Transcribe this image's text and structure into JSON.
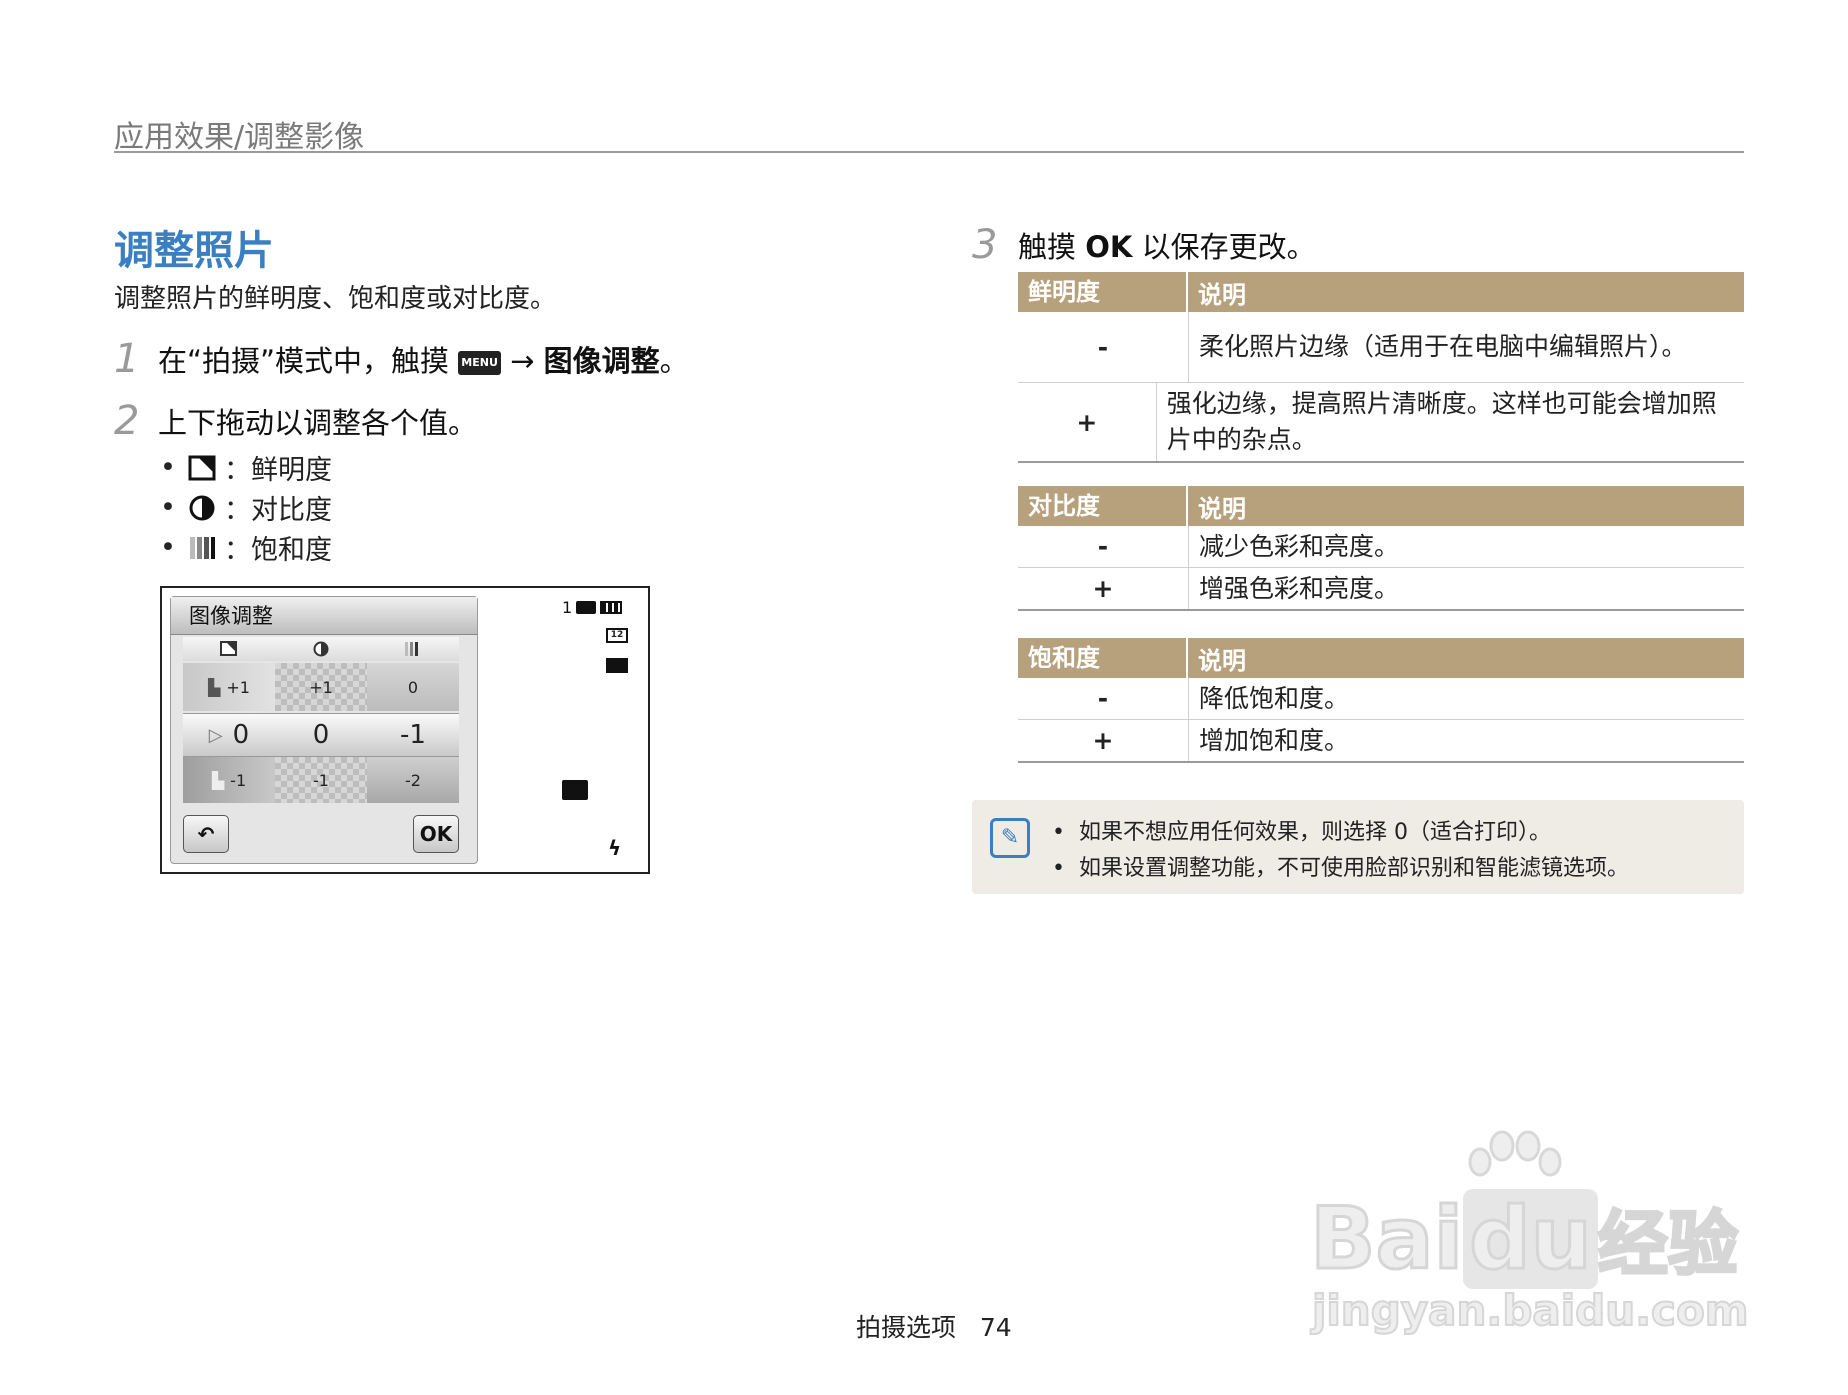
{
  "header": {
    "breadcrumb": "应用效果/调整影像"
  },
  "section": {
    "title": "调整照片",
    "description": "调整照片的鲜明度、饱和度或对比度。"
  },
  "steps": [
    {
      "num": "1",
      "pre": "在“拍摄”模式中，触摸",
      "menu_icon": "MENU",
      "arrow": "→",
      "bold": "图像调整",
      "post": "。"
    },
    {
      "num": "2",
      "text": "上下拖动以调整各个值。"
    },
    {
      "num": "3",
      "pre": "触摸",
      "bold": "OK",
      "post": "以保存更改。"
    }
  ],
  "bullets": [
    {
      "icon": "sharpness-icon",
      "label": "：鲜明度"
    },
    {
      "icon": "contrast-icon",
      "label": "：对比度"
    },
    {
      "icon": "saturation-icon",
      "label": "：饱和度"
    }
  ],
  "camera_screen": {
    "panel_title": "图像调整",
    "row_top": [
      "+1",
      "+1",
      "0"
    ],
    "row_mid": [
      "0",
      "0",
      "-1"
    ],
    "row_bot": [
      "-1",
      "-1",
      "-2"
    ],
    "ok_label": "OK",
    "shots_count": "1",
    "status_icons": [
      "memory-icon",
      "battery-icon",
      "resolution-icon",
      "metering-icon",
      "image-quality-icon",
      "flash-auto-icon"
    ]
  },
  "tables": [
    {
      "head": [
        "鲜明度",
        "说明"
      ],
      "rows": [
        {
          "k": "-",
          "v": "柔化照片边缘（适用于在电脑中编辑照片）。"
        },
        {
          "k": "+",
          "v": "强化边缘，提高照片清晰度。这样也可能会增加照片中的杂点。"
        }
      ]
    },
    {
      "head": [
        "对比度",
        "说明"
      ],
      "rows": [
        {
          "k": "-",
          "v": "减少色彩和亮度。"
        },
        {
          "k": "+",
          "v": "增强色彩和亮度。"
        }
      ]
    },
    {
      "head": [
        "饱和度",
        "说明"
      ],
      "rows": [
        {
          "k": "-",
          "v": "降低饱和度。"
        },
        {
          "k": "+",
          "v": "增加饱和度。"
        }
      ]
    }
  ],
  "note": {
    "lines": [
      "如果不想应用任何效果，则选择 0（适合打印）。",
      "如果设置调整功能，不可使用脸部识别和智能滤镜选项。"
    ]
  },
  "footer": {
    "section": "拍摄选项",
    "page": "74"
  },
  "watermark": {
    "brand": "Bai",
    "brand2": "du",
    "cn": "经验",
    "url": "jingyan.baidu.com"
  },
  "colors": {
    "accent": "#3a7fc1",
    "table_header": "#b7a07c",
    "note_bg": "#efebe5"
  }
}
